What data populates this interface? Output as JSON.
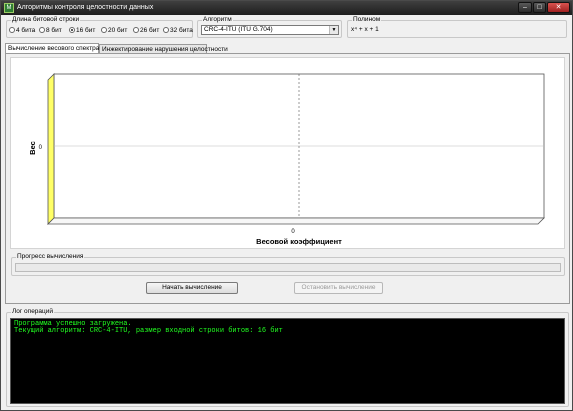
{
  "window": {
    "title": "Алгоритмы контроля целостности данных",
    "app_icon": "М"
  },
  "title_buttons": {
    "minimize": "–",
    "maximize": "□",
    "close": "✕"
  },
  "bit_length": {
    "label": "Длина битовой строки",
    "options": [
      {
        "label": "4 бита",
        "checked": false
      },
      {
        "label": "8 бит",
        "checked": false
      },
      {
        "label": "16 бит",
        "checked": true
      },
      {
        "label": "20 бит",
        "checked": false
      },
      {
        "label": "26 бит",
        "checked": false
      },
      {
        "label": "32 бита",
        "checked": false
      }
    ]
  },
  "algorithm": {
    "label": "Алгоритм",
    "selected": "CRC-4-ITU (ITU G.704)",
    "arrow": "▼"
  },
  "polynomial": {
    "label": "Полином",
    "value": "x⁴ + x + 1"
  },
  "tabs": [
    {
      "label": "Вычисление весового спектра",
      "active": true
    },
    {
      "label": "Инжектирование нарушения целостности",
      "active": false
    }
  ],
  "chart_data": {
    "type": "bar",
    "categories": [
      "0"
    ],
    "values": [
      0
    ],
    "xlabel": "Весовой коэффициент",
    "ylabel": "Вес",
    "y_ticks": [
      "0"
    ],
    "style": "3d",
    "colors": {
      "wall": "#ffff66",
      "floor": "#f7f7f7",
      "grid": "#555555"
    }
  },
  "progress": {
    "label": "Прогресс вычисления",
    "value_percent": 0,
    "fill_color": "#06b025"
  },
  "buttons": {
    "start": "Начать вычисление",
    "stop": "Остановить вычисление",
    "stop_enabled": false
  },
  "log": {
    "label": "Лог операций",
    "lines": [
      "Программа успешно загружена.",
      "Текущий алгоритм: CRC-4-ITU, размер входной строки битов: 16 бит"
    ],
    "text_color": "#21ff21"
  }
}
